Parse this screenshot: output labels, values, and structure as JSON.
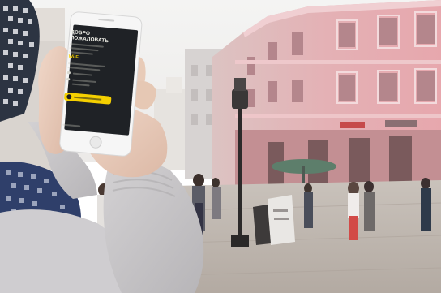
{
  "photo": {
    "description_colors": {
      "building": "#e3aeb3",
      "sky": "#f1f1f0",
      "pavement": "#bfb6ae",
      "sweater": "#c6c4c6",
      "phone_screen": "#1f2226",
      "accent_yellow": "#f5d000"
    },
    "phone_screen": {
      "title": "ДОБРО ПОЖАЛОВАТЬ",
      "network_label": "Wi-Fi",
      "icons": [
        "wifi-icon",
        "info-icon",
        "alert-icon"
      ]
    }
  }
}
